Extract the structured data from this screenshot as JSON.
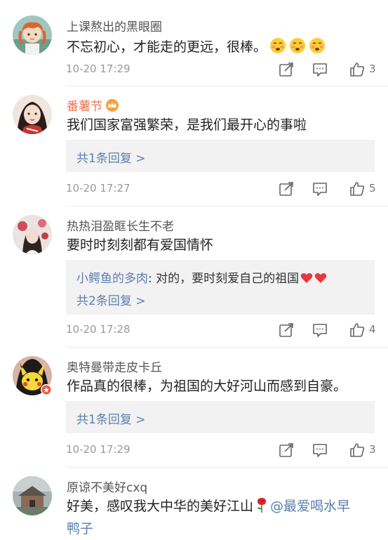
{
  "comments": [
    {
      "username": "上课熬出的黑眼圈",
      "text": "不忘初心，才能走的更远，很棒。",
      "emojis": [
        "blushing-face-icon",
        "blushing-face-icon",
        "blushing-face-icon"
      ],
      "timestamp": "10-20 17:29",
      "like_count": "3"
    },
    {
      "username": "番薯节",
      "badge": "crown-icon",
      "text": "我们国家富强繁荣，是我们最开心的事啦",
      "replies_label": "共1条回复 >",
      "timestamp": "10-20 17:27",
      "like_count": "5"
    },
    {
      "username": "热热泪盈眶长生不老",
      "text": "要时时刻刻都有爱国情怀",
      "reply_preview": {
        "user": "小鳄鱼的多肉",
        "separator": ":",
        "text": " 对的，要时刻爱自己的祖国",
        "emojis": [
          "red-heart-icon",
          "red-heart-icon"
        ]
      },
      "replies_label": "共2条回复 >",
      "timestamp": "10-20 17:28",
      "like_count": "4"
    },
    {
      "username": "奥特曼带走皮卡丘",
      "text": "作品真的很棒，为祖国的大好河山而感到自豪。",
      "replies_label": "共1条回复 >",
      "timestamp": "10-20 17:29",
      "like_count": "3"
    },
    {
      "username": "原谅不美好cxq",
      "text_before": "好美，感叹我大中华的美好江山",
      "text_mention": "@最爱喝水早",
      "text_line2": "鸭子"
    }
  ],
  "colors": {
    "username": "#555555",
    "vip_username": "#eb7350",
    "link": "#5b7fb0",
    "reply_bg": "#f2f2f2",
    "meta": "#9a9a9a"
  }
}
